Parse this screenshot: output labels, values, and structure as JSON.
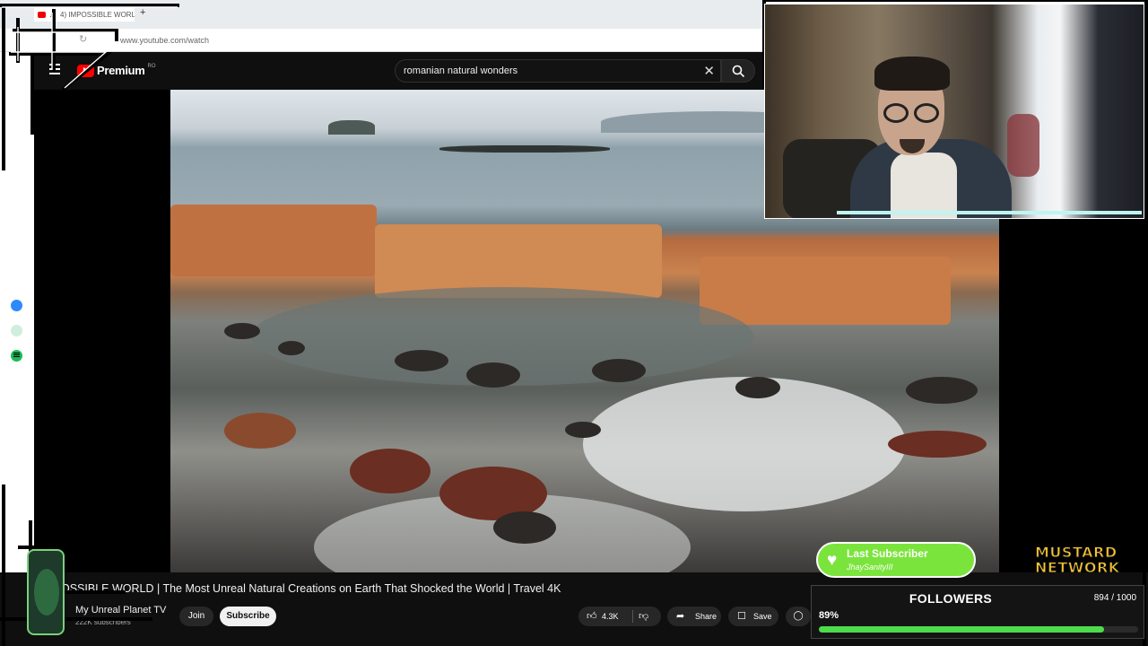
{
  "browser": {
    "tab_title": "4) IMPOSSIBLE WORL",
    "new_tab_symbol": "+",
    "url": "www.youtube.com/watch"
  },
  "youtube": {
    "logo_text": "Premium",
    "logo_region": "RO",
    "search_query": "romanian natural wonders"
  },
  "video": {
    "title": "OSSIBLE WORLD | The Most Unreal Natural Creations on Earth That Shocked the World | Travel 4K",
    "channel_name": "My Unreal Planet TV",
    "subscribers": "222K subscribers",
    "join_label": "Join",
    "subscribe_label": "Subscribe",
    "like_count": "4.3K",
    "share_label": "Share",
    "save_label": "Save"
  },
  "overlay": {
    "last_subscriber_title": "Last Subscriber",
    "last_subscriber_name": "JhaySanityIII",
    "followers_label": "FOLLOWERS",
    "followers_count": "894 / 1000",
    "followers_percent_label": "89%",
    "followers_progress": 0.894,
    "network_line1": "MUSTARD",
    "network_line2": "NETWORK"
  },
  "colors": {
    "youtube_red": "#ff0000",
    "progress_green": "#4cdc4c",
    "subscriber_pill": "#7be43c",
    "network_gold": "#f5c430"
  },
  "icons": [
    "menu-icon",
    "youtube-logo-icon",
    "clear-icon",
    "search-icon",
    "messenger-icon",
    "whatsapp-icon",
    "spotify-icon",
    "like-icon",
    "dislike-icon",
    "share-icon",
    "save-icon",
    "thanks-icon",
    "heart-icon"
  ]
}
